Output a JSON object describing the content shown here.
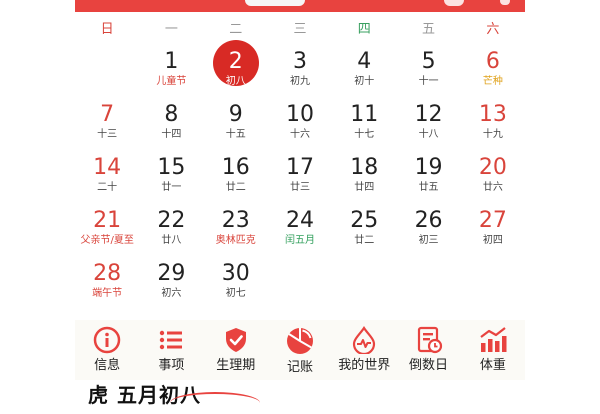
{
  "weekdays": [
    "日",
    "一",
    "二",
    "三",
    "四",
    "五",
    "六"
  ],
  "calendar": {
    "days": [
      {
        "num": "",
        "sub": ""
      },
      {
        "num": "1",
        "sub": "儿童节",
        "subtype": "festival"
      },
      {
        "num": "2",
        "sub": "初八",
        "today": true
      },
      {
        "num": "3",
        "sub": "初九"
      },
      {
        "num": "4",
        "sub": "初十"
      },
      {
        "num": "5",
        "sub": "十一"
      },
      {
        "num": "6",
        "sub": "芒种",
        "subtype": "term"
      },
      {
        "num": "7",
        "sub": "十三"
      },
      {
        "num": "8",
        "sub": "十四"
      },
      {
        "num": "9",
        "sub": "十五"
      },
      {
        "num": "10",
        "sub": "十六"
      },
      {
        "num": "11",
        "sub": "十七"
      },
      {
        "num": "12",
        "sub": "十八"
      },
      {
        "num": "13",
        "sub": "十九"
      },
      {
        "num": "14",
        "sub": "二十"
      },
      {
        "num": "15",
        "sub": "廿一"
      },
      {
        "num": "16",
        "sub": "廿二"
      },
      {
        "num": "17",
        "sub": "廿三"
      },
      {
        "num": "18",
        "sub": "廿四"
      },
      {
        "num": "19",
        "sub": "廿五"
      },
      {
        "num": "20",
        "sub": "廿六"
      },
      {
        "num": "21",
        "sub": "父亲节/夏至",
        "subtype": "festival"
      },
      {
        "num": "22",
        "sub": "廿八"
      },
      {
        "num": "23",
        "sub": "奥林匹克",
        "subtype": "festival"
      },
      {
        "num": "24",
        "sub": "闰五月",
        "subtype": "leap"
      },
      {
        "num": "25",
        "sub": "廿二"
      },
      {
        "num": "26",
        "sub": "初三"
      },
      {
        "num": "27",
        "sub": "初四"
      },
      {
        "num": "28",
        "sub": "端午节",
        "subtype": "festival"
      },
      {
        "num": "29",
        "sub": "初六"
      },
      {
        "num": "30",
        "sub": "初七"
      }
    ]
  },
  "toolbar": {
    "items": [
      {
        "label": "信息",
        "icon": "info-icon"
      },
      {
        "label": "事项",
        "icon": "list-icon"
      },
      {
        "label": "生理期",
        "icon": "shield-check-icon"
      },
      {
        "label": "记账",
        "icon": "pie-chart-icon"
      },
      {
        "label": "我的世界",
        "icon": "heartbeat-drop-icon"
      },
      {
        "label": "倒数日",
        "icon": "countdown-icon"
      },
      {
        "label": "体重",
        "icon": "bar-trend-icon"
      }
    ]
  },
  "bottom": {
    "text": "虎 五月初八"
  },
  "colors": {
    "accent": "#e8433f",
    "today": "#d82a25",
    "weekend": "#d9443b",
    "term": "#e0a21b",
    "leap": "#2f9e5a"
  }
}
